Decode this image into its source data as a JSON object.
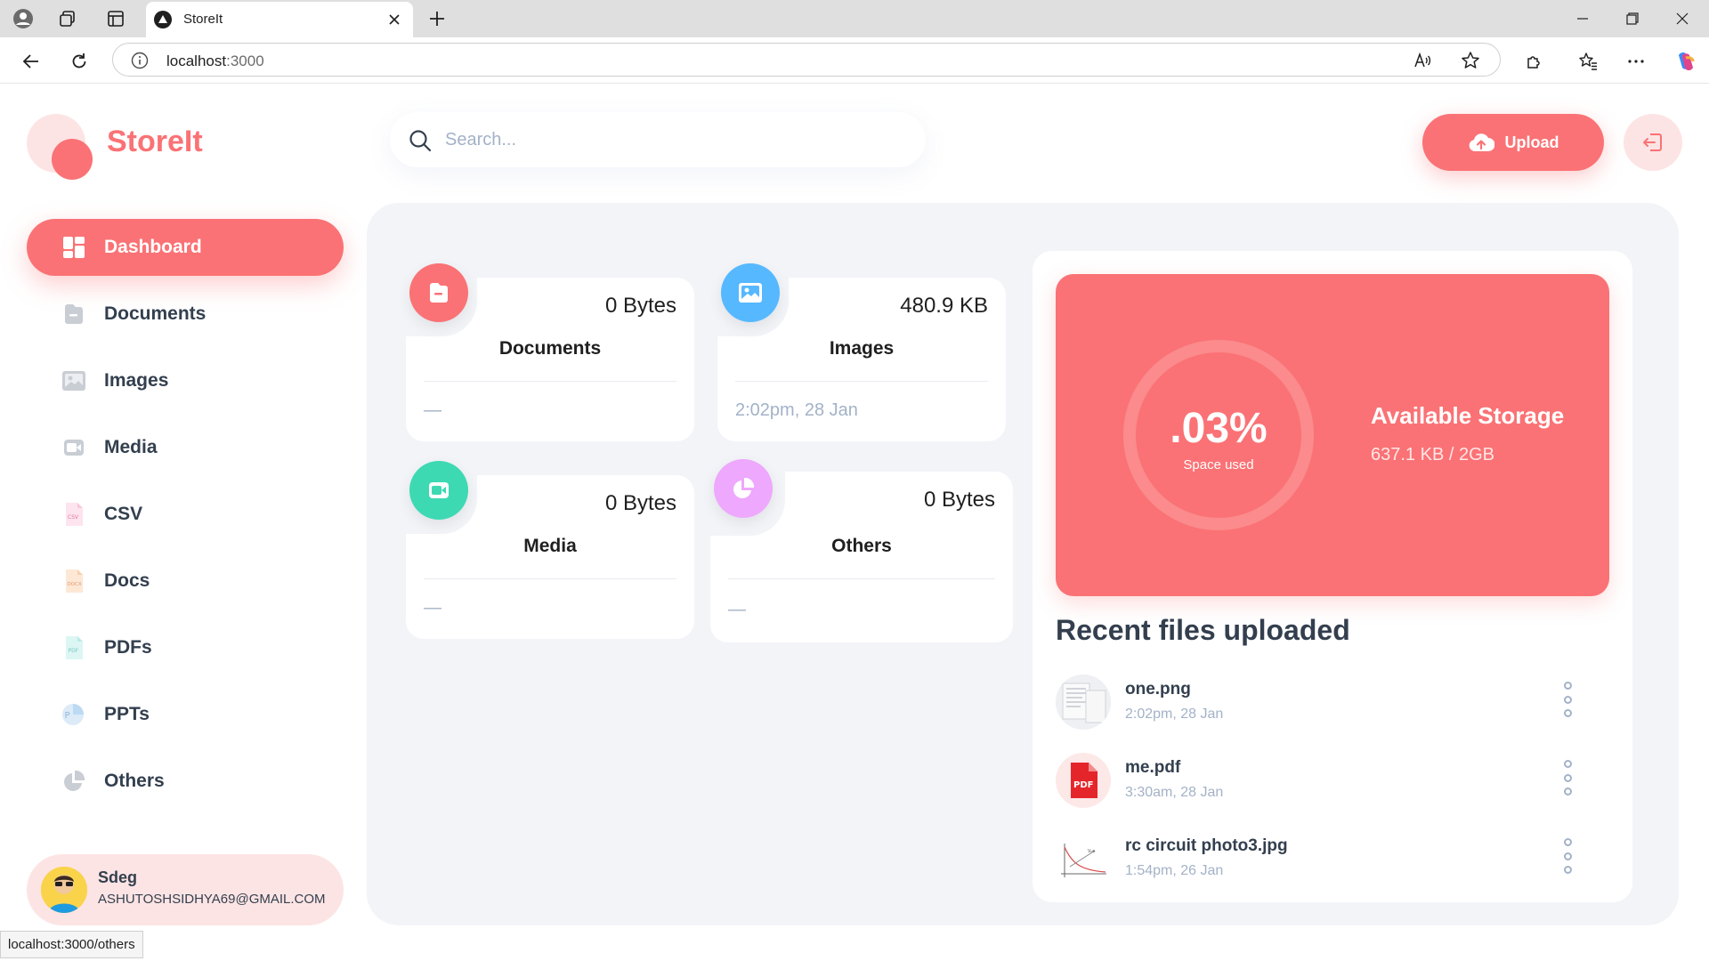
{
  "browser": {
    "tab_title": "StoreIt",
    "url_host": "localhost",
    "url_port": ":3000",
    "status_url": "localhost:3000/others"
  },
  "app": {
    "logo_text": "StoreIt",
    "search_placeholder": "Search...",
    "upload_label": "Upload",
    "brand_color": "#fa7275"
  },
  "sidebar": {
    "items": [
      {
        "label": "Dashboard",
        "icon": "dashboard-icon",
        "active": true
      },
      {
        "label": "Documents",
        "icon": "documents-icon"
      },
      {
        "label": "Images",
        "icon": "images-icon"
      },
      {
        "label": "Media",
        "icon": "media-icon"
      },
      {
        "label": "CSV",
        "icon": "csv-icon"
      },
      {
        "label": "Docs",
        "icon": "docx-icon"
      },
      {
        "label": "PDFs",
        "icon": "pdf-icon"
      },
      {
        "label": "PPTs",
        "icon": "ppt-icon"
      },
      {
        "label": "Others",
        "icon": "pie-chart-icon"
      }
    ]
  },
  "user": {
    "name": "Sdeg",
    "email": "ASHUTOSHSIDHYA69@GMAIL.COM"
  },
  "summary_cards": [
    {
      "title": "Documents",
      "size": "0 Bytes",
      "date": "—",
      "color": "#fa7275"
    },
    {
      "title": "Images",
      "size": "480.9 KB",
      "date": "2:02pm, 28 Jan",
      "color": "#56b8ff"
    },
    {
      "title": "Media",
      "size": "0 Bytes",
      "date": "—",
      "color": "#3dd9b3"
    },
    {
      "title": "Others",
      "size": "0 Bytes",
      "date": "—",
      "color": "#eea8fd"
    }
  ],
  "storage": {
    "percent": ".03%",
    "percent_label": "Space used",
    "title": "Available Storage",
    "used": "637.1 KB / 2GB"
  },
  "recent": {
    "title": "Recent files uploaded",
    "files": [
      {
        "name": "one.png",
        "date": "2:02pm, 28 Jan",
        "thumb": "image-thumbnail"
      },
      {
        "name": "me.pdf",
        "date": "3:30am, 28 Jan",
        "thumb": "pdf-icon"
      },
      {
        "name": "rc circuit photo3.jpg",
        "date": "1:54pm, 26 Jan",
        "thumb": "image-thumbnail"
      }
    ]
  }
}
